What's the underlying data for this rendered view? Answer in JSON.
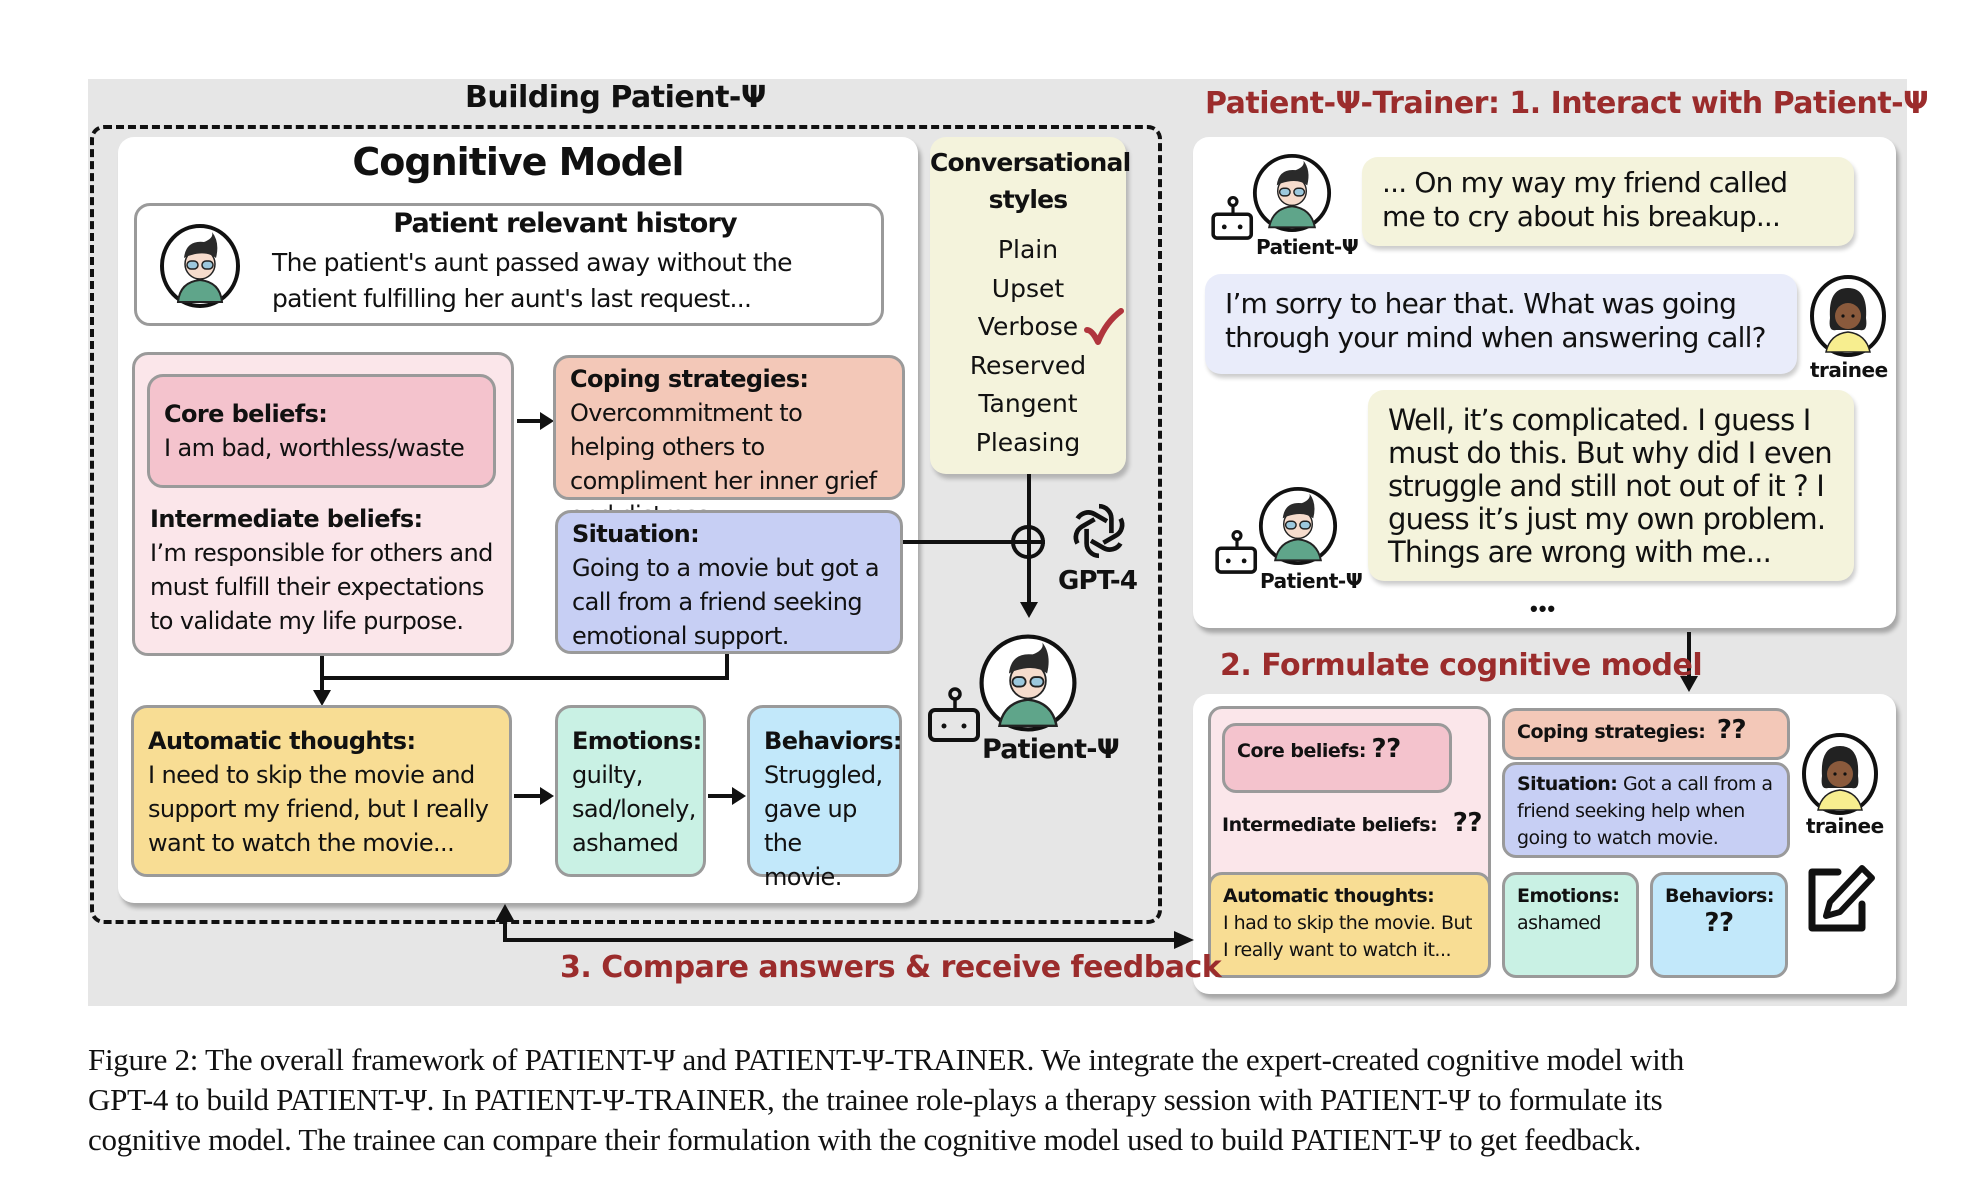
{
  "building": {
    "title": "Building Patient-Ψ",
    "cognitive_model": {
      "title": "Cognitive Model",
      "history": {
        "label": "Patient relevant history",
        "text": "The patient's aunt passed away without the patient fulfilling her aunt's last request..."
      },
      "core_beliefs": {
        "label": "Core beliefs:",
        "text": "I am bad, worthless/waste"
      },
      "intermediate_beliefs": {
        "label": "Intermediate beliefs:",
        "text": "I’m responsible for others and must fulfill their expectations to validate my life purpose."
      },
      "coping_strategies": {
        "label": "Coping strategies:",
        "text": "Overcommitment to helping others to compliment her inner grief and distress."
      },
      "situation": {
        "label": "Situation:",
        "text": "Going to a movie but got a call from a friend seeking emotional support."
      },
      "automatic_thoughts": {
        "label": "Automatic thoughts:",
        "text": "I need to skip the movie and support my friend, but I really want to watch the movie..."
      },
      "emotions": {
        "label": "Emotions:",
        "text": "guilty, sad/lonely, ashamed"
      },
      "behaviors": {
        "label": "Behaviors:",
        "text": "Struggled, gave up the movie."
      }
    },
    "conversational_styles": {
      "title": "Conversational styles",
      "options": [
        "Plain",
        "Upset",
        "Verbose",
        "Reserved",
        "Tangent",
        "Pleasing"
      ],
      "selected": "Verbose"
    },
    "gpt_label": "GPT-4",
    "patient_label": "Patient-Ψ"
  },
  "trainer": {
    "step1_title": "Patient-Ψ-Trainer: 1. Interact with Patient-Ψ",
    "messages": [
      {
        "speaker": "Patient-Ψ",
        "text": "... On my way my friend called me to cry about his breakup..."
      },
      {
        "speaker": "trainee",
        "text": "I’m sorry to hear that. What was going through your mind when answering call?"
      },
      {
        "speaker": "Patient-Ψ",
        "text": "Well, it’s complicated. I guess I must do this. But why did I even struggle and still not out of it ? I guess it’s just my own problem. Things are wrong with me..."
      }
    ],
    "ellipsis": "•••",
    "step2_title": "2. Formulate cognitive model",
    "formulation": {
      "core_beliefs": {
        "label": "Core beliefs:",
        "value": "??"
      },
      "intermediate_beliefs": {
        "label": "Intermediate beliefs:",
        "value": "??"
      },
      "coping_strategies": {
        "label": "Coping strategies:",
        "value": "??"
      },
      "situation": {
        "label": "Situation:",
        "value": "Got a call from a friend seeking help when going to watch movie."
      },
      "automatic_thoughts": {
        "label": "Automatic thoughts:",
        "value": "I had to skip the movie. But I really want to watch it..."
      },
      "emotions": {
        "label": "Emotions:",
        "value": "ashamed"
      },
      "behaviors": {
        "label": "Behaviors:",
        "value": "??"
      }
    },
    "trainee_label": "trainee",
    "step3_title": "3. Compare answers & receive feedback"
  },
  "caption": {
    "lines": [
      "Figure 2: The overall framework of PATIENT-Ψ and PATIENT-Ψ-TRAINER. We integrate the expert-created cognitive model with",
      "GPT-4 to build PATIENT-Ψ. In PATIENT-Ψ-TRAINER, the trainee role-plays a therapy session with PATIENT-Ψ to formulate its",
      "cognitive model. The trainee can compare their formulation with the cognitive model used to build PATIENT-Ψ to get feedback."
    ]
  },
  "colors": {
    "accent_red": "#9b2c2c",
    "check_red": "#b0353d",
    "panel_gray": "#e6e6e6"
  }
}
